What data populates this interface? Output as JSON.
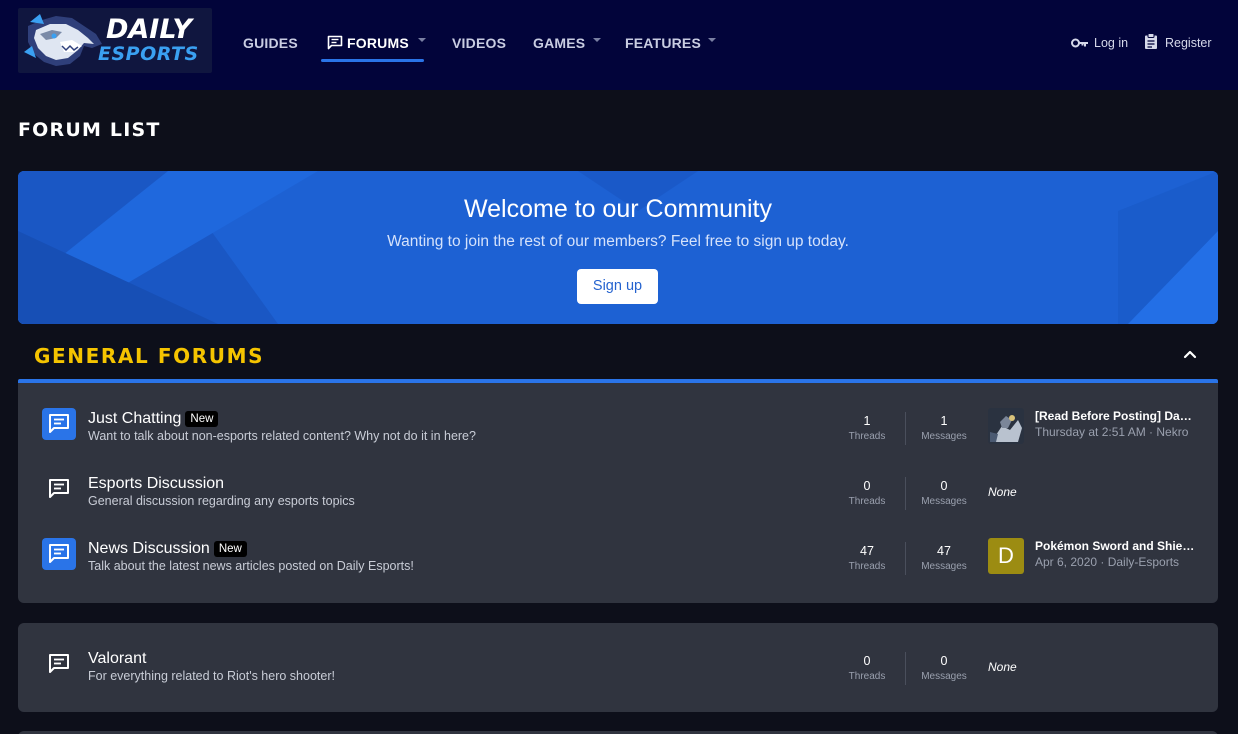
{
  "header": {
    "logo": {
      "line1": "DAILY",
      "line2": "ESPORTS"
    },
    "nav": [
      {
        "label": "GUIDES"
      },
      {
        "label": "FORUMS"
      },
      {
        "label": "VIDEOS"
      },
      {
        "label": "GAMES"
      },
      {
        "label": "FEATURES"
      }
    ],
    "login": "Log in",
    "register": "Register"
  },
  "page": {
    "title": "FORUM LIST"
  },
  "banner": {
    "heading": "Welcome to our Community",
    "subtext": "Wanting to join the rest of our members? Feel free to sign up today.",
    "button": "Sign up"
  },
  "category": {
    "title": "GENERAL FORUMS"
  },
  "forums": [
    {
      "title": "Just Chatting",
      "badge": "New",
      "description": "Want to talk about non-esports related content? Why not do it in here?",
      "threads": "1",
      "messages": "1",
      "threads_label": "Threads",
      "messages_label": "Messages",
      "last_post_title": "[Read Before Posting] Daily Esports Forum Rules",
      "last_post_meta": "Thursday at 2:51 AM · Nekro"
    },
    {
      "title": "Esports Discussion",
      "description": "General discussion regarding any esports topics",
      "threads": "0",
      "messages": "0",
      "threads_label": "Threads",
      "messages_label": "Messages",
      "none_label": "None"
    },
    {
      "title": "News Discussion",
      "badge": "New",
      "description": "Talk about the latest news articles posted on Daily Esports!",
      "threads": "47",
      "messages": "47",
      "threads_label": "Threads",
      "messages_label": "Messages",
      "avatar_letter": "D",
      "last_post_title": "Pokémon Sword and Shield Crown Tundra",
      "last_post_meta": "Apr 6, 2020 · Daily-Esports"
    },
    {
      "title": "Valorant",
      "description": "For everything related to Riot's hero shooter!",
      "threads": "0",
      "messages": "0",
      "threads_label": "Threads",
      "messages_label": "Messages",
      "none_label": "None"
    }
  ],
  "colors": {
    "header_bg": "#02043a",
    "page_bg": "#0d0f1a",
    "accent": "#2a74e8",
    "category_title": "#f5c400",
    "node_bg": "#30343f",
    "avatar_d": "#9c8c12"
  }
}
